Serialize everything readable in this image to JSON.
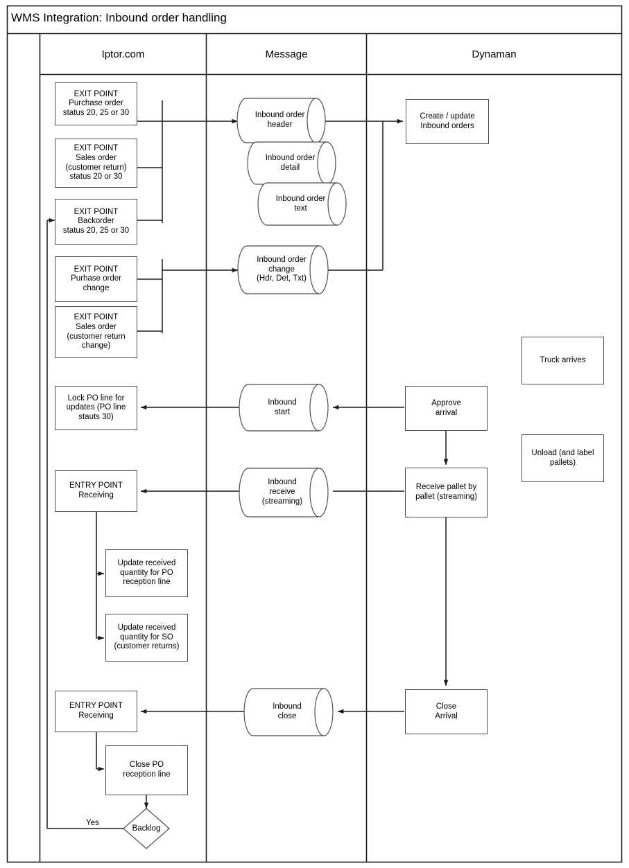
{
  "diagram": {
    "title": "WMS Integration: Inbound order handling",
    "lanes": [
      {
        "id": "iptor",
        "label": "Iptor.com"
      },
      {
        "id": "message",
        "label": "Message"
      },
      {
        "id": "dynaman",
        "label": "Dynaman"
      }
    ],
    "nodes": [
      {
        "id": "exit-po-status",
        "shape": "rect",
        "lane": "iptor",
        "text": "EXIT POINT\nPurchase order\nstatus 20, 25 or 30"
      },
      {
        "id": "exit-so-status",
        "shape": "rect",
        "lane": "iptor",
        "text": "EXIT POINT\nSales order\n(customer return)\nstatus 20 or 30"
      },
      {
        "id": "exit-backorder",
        "shape": "rect",
        "lane": "iptor",
        "text": "EXIT POINT\nBackorder\nstatus 20, 25 or 30"
      },
      {
        "id": "exit-po-change",
        "shape": "rect",
        "lane": "iptor",
        "text": "EXIT POINT\nPurhase order\nchange"
      },
      {
        "id": "exit-so-change",
        "shape": "rect",
        "lane": "iptor",
        "text": "EXIT POINT\nSales order\n(customer return\nchange)"
      },
      {
        "id": "msg-inbound-header",
        "shape": "cylinder",
        "lane": "message",
        "text": "Inbound order\nheader"
      },
      {
        "id": "msg-inbound-detail",
        "shape": "cylinder",
        "lane": "message",
        "text": "Inbound order\ndetail"
      },
      {
        "id": "msg-inbound-text",
        "shape": "cylinder",
        "lane": "message",
        "text": "Inbound order\ntext"
      },
      {
        "id": "msg-inbound-change",
        "shape": "cylinder",
        "lane": "message",
        "text": "Inbound order\nchange\n(Hdr, Det, Txt)"
      },
      {
        "id": "dyn-create-update",
        "shape": "rect",
        "lane": "dynaman",
        "text": "Create / update\nInbound orders"
      },
      {
        "id": "dyn-truck-arrives",
        "shape": "rect",
        "lane": "dynaman",
        "text": "Truck arrives"
      },
      {
        "id": "dyn-unload",
        "shape": "rect",
        "lane": "dynaman",
        "text": "Unload (and label\npallets)"
      },
      {
        "id": "lock-po-line",
        "shape": "rect",
        "lane": "iptor",
        "text": "Lock PO line for\nupdates (PO line\nstauts 30)"
      },
      {
        "id": "msg-inbound-start",
        "shape": "cylinder",
        "lane": "message",
        "text": "Inbound\nstart"
      },
      {
        "id": "dyn-approve-arrival",
        "shape": "rect",
        "lane": "dynaman",
        "text": "Approve\narrival"
      },
      {
        "id": "entry-receiving-1",
        "shape": "rect",
        "lane": "iptor",
        "text": "ENTRY POINT\nReceiving"
      },
      {
        "id": "msg-inbound-receive",
        "shape": "cylinder",
        "lane": "message",
        "text": "Inbound\nreceive\n(streaming)"
      },
      {
        "id": "dyn-receive-pallet",
        "shape": "rect",
        "lane": "dynaman",
        "text": "Receive pallet by\npallet (streaming)"
      },
      {
        "id": "update-qty-po",
        "shape": "rect",
        "lane": "iptor",
        "text": "Update received\nquantity for PO\nreception line"
      },
      {
        "id": "update-qty-so",
        "shape": "rect",
        "lane": "iptor",
        "text": "Update received\nquantity for SO\n(customer returns)"
      },
      {
        "id": "entry-receiving-2",
        "shape": "rect",
        "lane": "iptor",
        "text": "ENTRY POINT\nReceiving"
      },
      {
        "id": "msg-inbound-close",
        "shape": "cylinder",
        "lane": "message",
        "text": "Inbound\nclose"
      },
      {
        "id": "dyn-close-arrival",
        "shape": "rect",
        "lane": "dynaman",
        "text": "Close\nArrival"
      },
      {
        "id": "close-po-line",
        "shape": "rect",
        "lane": "iptor",
        "text": "Close PO\nreception line"
      },
      {
        "id": "backlog-decision",
        "shape": "diamond",
        "lane": "iptor",
        "text": "Backlog"
      }
    ],
    "edge_labels": [
      {
        "id": "backlog-yes",
        "text": "Yes"
      }
    ],
    "colors": {
      "stroke": "#4d4d4d",
      "frame": "#1a1a1a",
      "connector": "#1a1a1a",
      "background": "#ffffff",
      "text": "#000000"
    }
  }
}
